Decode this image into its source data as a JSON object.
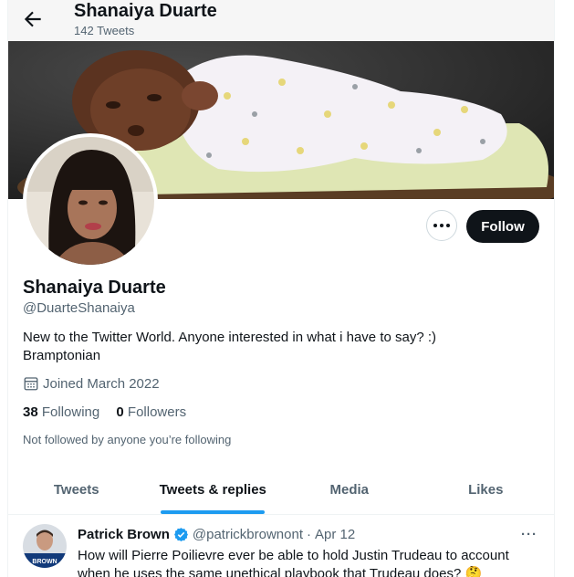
{
  "header": {
    "name": "Shanaiya Duarte",
    "tweet_count": "142 Tweets"
  },
  "profile": {
    "name": "Shanaiya Duarte",
    "handle": "@DuarteShanaiya",
    "bio_line1": "New to the Twitter World. Anyone interested in what i have to say? :)",
    "bio_line2": "Bramptonian",
    "joined": "Joined March 2022",
    "following_count": "38",
    "following_label": "Following",
    "followers_count": "0",
    "followers_label": "Followers",
    "not_followed": "Not followed by anyone you’re following"
  },
  "actions": {
    "follow_label": "Follow",
    "more_icon": "more-horizontal-icon"
  },
  "tabs": [
    {
      "label": "Tweets",
      "active": false
    },
    {
      "label": "Tweets & replies",
      "active": true
    },
    {
      "label": "Media",
      "active": false
    },
    {
      "label": "Likes",
      "active": false
    }
  ],
  "tweet": {
    "author": "Patrick Brown",
    "handle": "@patrickbrownont",
    "separator": "·",
    "date": "Apr 12",
    "text_line1": "How will Pierre Poilievre ever be able to hold Justin Trudeau to account",
    "text_line2": "when he uses the same unethical playbook that Trudeau does? 🤔",
    "avatar_caption": "BROWN",
    "verified_icon": "verified-badge-icon"
  },
  "colors": {
    "accent": "#1d9bf0",
    "text": "#0f1419",
    "muted": "#536471",
    "follow_bg": "#0f1419"
  }
}
